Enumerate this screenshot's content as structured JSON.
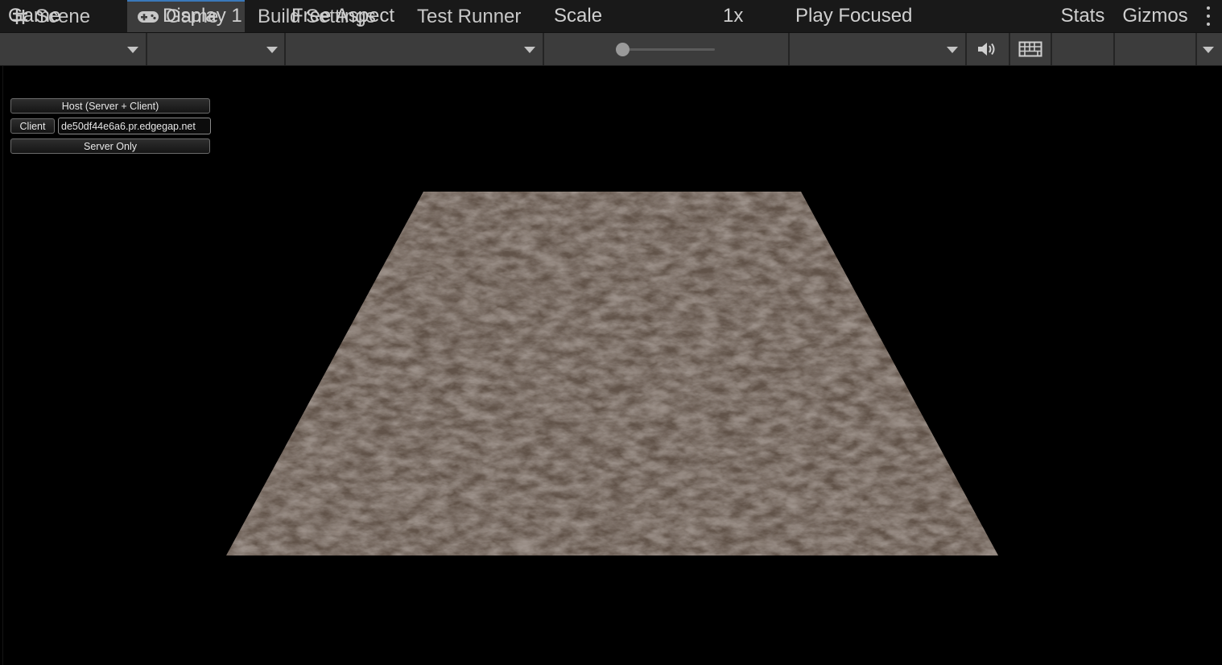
{
  "tabs": [
    {
      "label": "Scene",
      "icon": "hash-icon"
    },
    {
      "label": "Game",
      "icon": "gamepad-icon"
    },
    {
      "label": "Build Settings"
    },
    {
      "label": "Test Runner"
    }
  ],
  "toolbar": {
    "view_dropdown": "Game",
    "display_dropdown": "Display 1",
    "aspect_dropdown": "Free Aspect",
    "scale_label": "Scale",
    "scale_value": "1x",
    "scale_level": 0,
    "play_mode_dropdown": "Play Focused",
    "stats_label": "Stats",
    "gizmos_label": "Gizmos"
  },
  "network_hud": {
    "host_button": "Host (Server + Client)",
    "client_button": "Client",
    "address_value": "de50df44e6a6.pr.edgegap.net",
    "server_button": "Server Only"
  },
  "colors": {
    "editor_background": "#3c3c3c",
    "tab_bar": "#191919",
    "active_tab_accent": "#3a79bb",
    "game_background": "#000000",
    "ground_base": "#615349"
  }
}
